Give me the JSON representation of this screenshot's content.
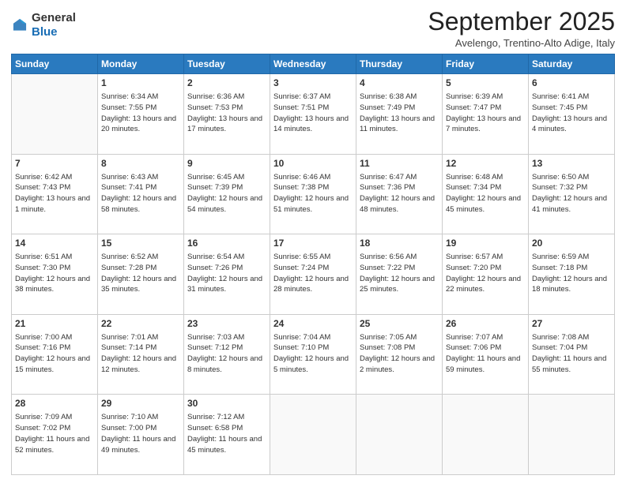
{
  "header": {
    "logo_general": "General",
    "logo_blue": "Blue",
    "month_title": "September 2025",
    "location": "Avelengo, Trentino-Alto Adige, Italy"
  },
  "weekdays": [
    "Sunday",
    "Monday",
    "Tuesday",
    "Wednesday",
    "Thursday",
    "Friday",
    "Saturday"
  ],
  "weeks": [
    [
      {
        "day": "",
        "sunrise": "",
        "sunset": "",
        "daylight": ""
      },
      {
        "day": "1",
        "sunrise": "Sunrise: 6:34 AM",
        "sunset": "Sunset: 7:55 PM",
        "daylight": "Daylight: 13 hours and 20 minutes."
      },
      {
        "day": "2",
        "sunrise": "Sunrise: 6:36 AM",
        "sunset": "Sunset: 7:53 PM",
        "daylight": "Daylight: 13 hours and 17 minutes."
      },
      {
        "day": "3",
        "sunrise": "Sunrise: 6:37 AM",
        "sunset": "Sunset: 7:51 PM",
        "daylight": "Daylight: 13 hours and 14 minutes."
      },
      {
        "day": "4",
        "sunrise": "Sunrise: 6:38 AM",
        "sunset": "Sunset: 7:49 PM",
        "daylight": "Daylight: 13 hours and 11 minutes."
      },
      {
        "day": "5",
        "sunrise": "Sunrise: 6:39 AM",
        "sunset": "Sunset: 7:47 PM",
        "daylight": "Daylight: 13 hours and 7 minutes."
      },
      {
        "day": "6",
        "sunrise": "Sunrise: 6:41 AM",
        "sunset": "Sunset: 7:45 PM",
        "daylight": "Daylight: 13 hours and 4 minutes."
      }
    ],
    [
      {
        "day": "7",
        "sunrise": "Sunrise: 6:42 AM",
        "sunset": "Sunset: 7:43 PM",
        "daylight": "Daylight: 13 hours and 1 minute."
      },
      {
        "day": "8",
        "sunrise": "Sunrise: 6:43 AM",
        "sunset": "Sunset: 7:41 PM",
        "daylight": "Daylight: 12 hours and 58 minutes."
      },
      {
        "day": "9",
        "sunrise": "Sunrise: 6:45 AM",
        "sunset": "Sunset: 7:39 PM",
        "daylight": "Daylight: 12 hours and 54 minutes."
      },
      {
        "day": "10",
        "sunrise": "Sunrise: 6:46 AM",
        "sunset": "Sunset: 7:38 PM",
        "daylight": "Daylight: 12 hours and 51 minutes."
      },
      {
        "day": "11",
        "sunrise": "Sunrise: 6:47 AM",
        "sunset": "Sunset: 7:36 PM",
        "daylight": "Daylight: 12 hours and 48 minutes."
      },
      {
        "day": "12",
        "sunrise": "Sunrise: 6:48 AM",
        "sunset": "Sunset: 7:34 PM",
        "daylight": "Daylight: 12 hours and 45 minutes."
      },
      {
        "day": "13",
        "sunrise": "Sunrise: 6:50 AM",
        "sunset": "Sunset: 7:32 PM",
        "daylight": "Daylight: 12 hours and 41 minutes."
      }
    ],
    [
      {
        "day": "14",
        "sunrise": "Sunrise: 6:51 AM",
        "sunset": "Sunset: 7:30 PM",
        "daylight": "Daylight: 12 hours and 38 minutes."
      },
      {
        "day": "15",
        "sunrise": "Sunrise: 6:52 AM",
        "sunset": "Sunset: 7:28 PM",
        "daylight": "Daylight: 12 hours and 35 minutes."
      },
      {
        "day": "16",
        "sunrise": "Sunrise: 6:54 AM",
        "sunset": "Sunset: 7:26 PM",
        "daylight": "Daylight: 12 hours and 31 minutes."
      },
      {
        "day": "17",
        "sunrise": "Sunrise: 6:55 AM",
        "sunset": "Sunset: 7:24 PM",
        "daylight": "Daylight: 12 hours and 28 minutes."
      },
      {
        "day": "18",
        "sunrise": "Sunrise: 6:56 AM",
        "sunset": "Sunset: 7:22 PM",
        "daylight": "Daylight: 12 hours and 25 minutes."
      },
      {
        "day": "19",
        "sunrise": "Sunrise: 6:57 AM",
        "sunset": "Sunset: 7:20 PM",
        "daylight": "Daylight: 12 hours and 22 minutes."
      },
      {
        "day": "20",
        "sunrise": "Sunrise: 6:59 AM",
        "sunset": "Sunset: 7:18 PM",
        "daylight": "Daylight: 12 hours and 18 minutes."
      }
    ],
    [
      {
        "day": "21",
        "sunrise": "Sunrise: 7:00 AM",
        "sunset": "Sunset: 7:16 PM",
        "daylight": "Daylight: 12 hours and 15 minutes."
      },
      {
        "day": "22",
        "sunrise": "Sunrise: 7:01 AM",
        "sunset": "Sunset: 7:14 PM",
        "daylight": "Daylight: 12 hours and 12 minutes."
      },
      {
        "day": "23",
        "sunrise": "Sunrise: 7:03 AM",
        "sunset": "Sunset: 7:12 PM",
        "daylight": "Daylight: 12 hours and 8 minutes."
      },
      {
        "day": "24",
        "sunrise": "Sunrise: 7:04 AM",
        "sunset": "Sunset: 7:10 PM",
        "daylight": "Daylight: 12 hours and 5 minutes."
      },
      {
        "day": "25",
        "sunrise": "Sunrise: 7:05 AM",
        "sunset": "Sunset: 7:08 PM",
        "daylight": "Daylight: 12 hours and 2 minutes."
      },
      {
        "day": "26",
        "sunrise": "Sunrise: 7:07 AM",
        "sunset": "Sunset: 7:06 PM",
        "daylight": "Daylight: 11 hours and 59 minutes."
      },
      {
        "day": "27",
        "sunrise": "Sunrise: 7:08 AM",
        "sunset": "Sunset: 7:04 PM",
        "daylight": "Daylight: 11 hours and 55 minutes."
      }
    ],
    [
      {
        "day": "28",
        "sunrise": "Sunrise: 7:09 AM",
        "sunset": "Sunset: 7:02 PM",
        "daylight": "Daylight: 11 hours and 52 minutes."
      },
      {
        "day": "29",
        "sunrise": "Sunrise: 7:10 AM",
        "sunset": "Sunset: 7:00 PM",
        "daylight": "Daylight: 11 hours and 49 minutes."
      },
      {
        "day": "30",
        "sunrise": "Sunrise: 7:12 AM",
        "sunset": "Sunset: 6:58 PM",
        "daylight": "Daylight: 11 hours and 45 minutes."
      },
      {
        "day": "",
        "sunrise": "",
        "sunset": "",
        "daylight": ""
      },
      {
        "day": "",
        "sunrise": "",
        "sunset": "",
        "daylight": ""
      },
      {
        "day": "",
        "sunrise": "",
        "sunset": "",
        "daylight": ""
      },
      {
        "day": "",
        "sunrise": "",
        "sunset": "",
        "daylight": ""
      }
    ]
  ]
}
